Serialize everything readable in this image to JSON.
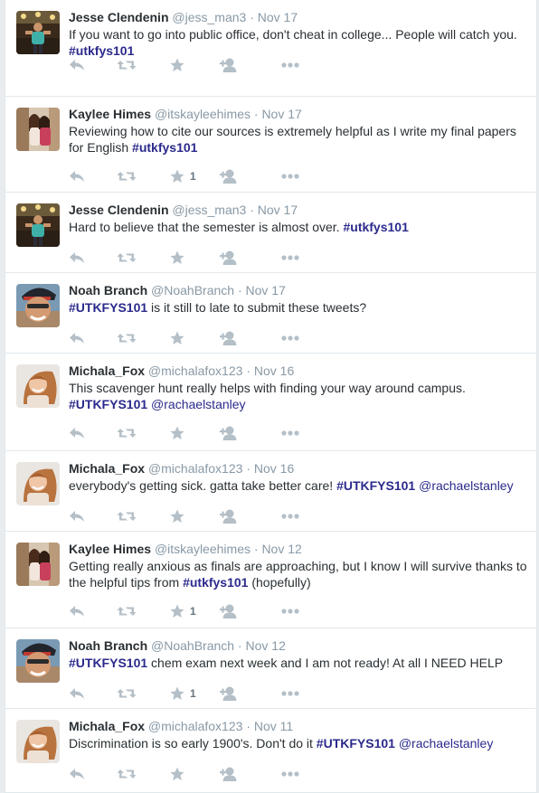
{
  "tweets": [
    {
      "fullname": "Jesse Clendenin",
      "username": "@jess_man3",
      "dot": "·",
      "time": "Nov 17",
      "parts": [
        {
          "t": "text",
          "v": "If you want to go into public office, don't cheat in college... People will catch you. "
        },
        {
          "t": "hashtag",
          "v": "#utkfys101"
        }
      ],
      "like_count": "",
      "avatar": "jesse"
    },
    {
      "fullname": "Kaylee Himes",
      "username": "@itskayleehimes",
      "dot": "·",
      "time": "Nov 17",
      "parts": [
        {
          "t": "text",
          "v": "Reviewing how to cite our sources is extremely helpful as I write my final papers for English "
        },
        {
          "t": "hashtag",
          "v": "#utkfys101"
        }
      ],
      "like_count": "1",
      "avatar": "kaylee"
    },
    {
      "fullname": "Jesse Clendenin",
      "username": "@jess_man3",
      "dot": "·",
      "time": "Nov 17",
      "parts": [
        {
          "t": "text",
          "v": "Hard to believe that the semester is almost over. "
        },
        {
          "t": "hashtag",
          "v": "#utkfys101"
        }
      ],
      "like_count": "",
      "avatar": "jesse"
    },
    {
      "fullname": "Noah Branch",
      "username": "@NoahBranch",
      "dot": "·",
      "time": "Nov 17",
      "parts": [
        {
          "t": "hashtag",
          "v": "#UTKFYS101"
        },
        {
          "t": "text",
          "v": " is it still to late to submit these tweets?"
        }
      ],
      "like_count": "",
      "avatar": "noah"
    },
    {
      "fullname": "Michala_Fox",
      "username": "@michalafox123",
      "dot": "·",
      "time": "Nov 16",
      "parts": [
        {
          "t": "text",
          "v": "This scavenger hunt really helps with finding your way around campus. "
        },
        {
          "t": "hashtag",
          "v": "#UTKFYS101"
        },
        {
          "t": "text",
          "v": " "
        },
        {
          "t": "mention",
          "v": "@rachaelstanley"
        }
      ],
      "like_count": "",
      "avatar": "michala"
    },
    {
      "fullname": "Michala_Fox",
      "username": "@michalafox123",
      "dot": "·",
      "time": "Nov 16",
      "parts": [
        {
          "t": "text",
          "v": "everybody's getting sick. gatta take better care! "
        },
        {
          "t": "hashtag",
          "v": "#UTKFYS101"
        },
        {
          "t": "text",
          "v": " "
        },
        {
          "t": "mention",
          "v": "@rachaelstanley"
        }
      ],
      "like_count": "",
      "avatar": "michala"
    },
    {
      "fullname": "Kaylee Himes",
      "username": "@itskayleehimes",
      "dot": "·",
      "time": "Nov 12",
      "parts": [
        {
          "t": "text",
          "v": "Getting really anxious as finals are approaching, but I know I will survive thanks to the helpful tips from "
        },
        {
          "t": "hashtag",
          "v": "#utkfys101"
        },
        {
          "t": "text",
          "v": " (hopefully)"
        }
      ],
      "like_count": "1",
      "avatar": "kaylee"
    },
    {
      "fullname": "Noah Branch",
      "username": "@NoahBranch",
      "dot": "·",
      "time": "Nov 12",
      "parts": [
        {
          "t": "hashtag",
          "v": "#UTKFYS101"
        },
        {
          "t": "text",
          "v": " chem exam next week and I am not ready! At all I NEED HELP"
        }
      ],
      "like_count": "1",
      "avatar": "noah"
    },
    {
      "fullname": "Michala_Fox",
      "username": "@michalafox123",
      "dot": "·",
      "time": "Nov 11",
      "parts": [
        {
          "t": "text",
          "v": "Discrimination is so early 1900's. Don't do it "
        },
        {
          "t": "hashtag",
          "v": "#UTKFYS101"
        },
        {
          "t": "text",
          "v": " "
        },
        {
          "t": "mention",
          "v": "@rachaelstanley"
        }
      ],
      "like_count": "",
      "avatar": "michala"
    }
  ],
  "icons": {
    "reply": "reply-icon",
    "retweet": "retweet-icon",
    "like": "star-icon",
    "follow": "follow-icon",
    "more": "more-icon"
  },
  "colors": {
    "hashtag": "#2b2a8c",
    "action": "#b4bfc7",
    "meta": "#8899a6"
  }
}
